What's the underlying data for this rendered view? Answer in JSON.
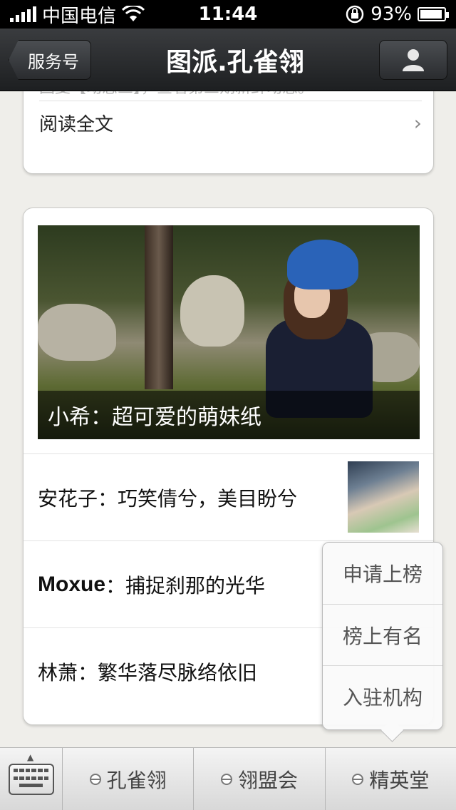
{
  "status_bar": {
    "carrier": "中国电信",
    "time": "11:44",
    "battery_percent": "93%",
    "battery_level": 0.93
  },
  "nav": {
    "back_label": "服务号",
    "title": "图派.孔雀翎"
  },
  "previous_card": {
    "tail_text": "回复【动态三】，查看第三期新鲜动态。",
    "read_more_label": "阅读全文"
  },
  "main_card": {
    "hero_caption": "小希：超可爱的萌妹纸",
    "articles": [
      {
        "title": "安花子：巧笑倩兮，美目盼兮"
      },
      {
        "author": "Moxue",
        "title_rest": "：捕捉刹那的光华"
      },
      {
        "title": "林萧：繁华落尽脉络依旧"
      }
    ]
  },
  "submenu": {
    "items": [
      "申请上榜",
      "榜上有名",
      "入驻机构"
    ]
  },
  "bottom_menu": {
    "tabs": [
      "孔雀翎",
      "翎盟会",
      "精英堂"
    ]
  }
}
